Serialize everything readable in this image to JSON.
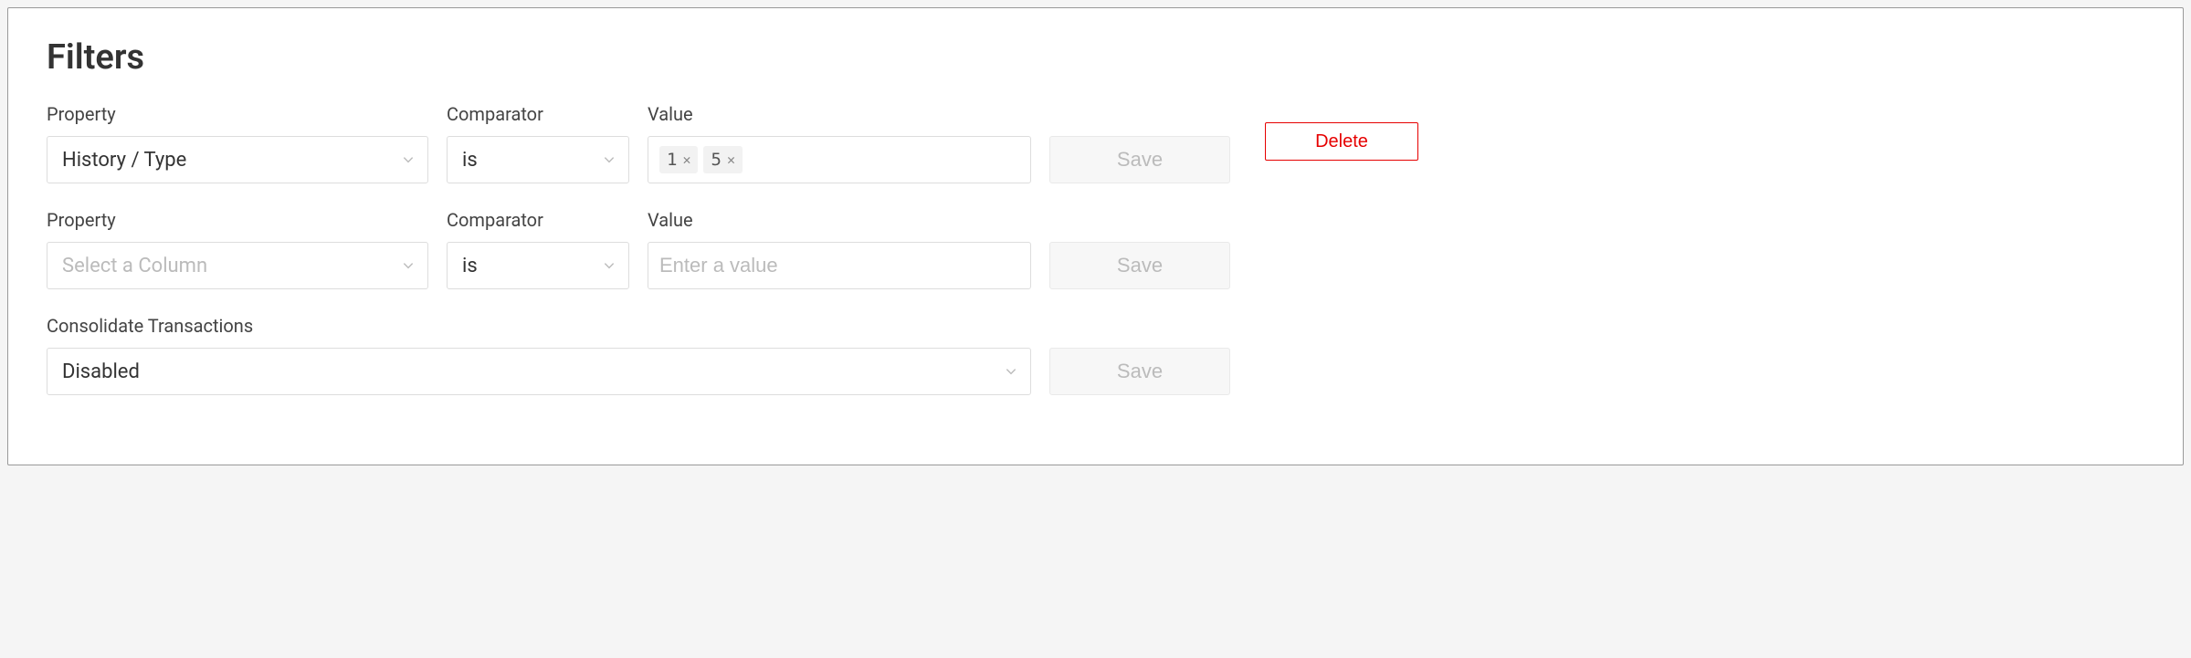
{
  "title": "Filters",
  "labels": {
    "property": "Property",
    "comparator": "Comparator",
    "value": "Value",
    "consolidate": "Consolidate Transactions"
  },
  "actions": {
    "save": "Save",
    "delete": "Delete"
  },
  "placeholders": {
    "selectColumn": "Select a Column",
    "enterValue": "Enter a value"
  },
  "filters": [
    {
      "property": "History / Type",
      "comparator": "is",
      "valueTags": [
        "1",
        "5"
      ]
    },
    {
      "property": "",
      "comparator": "is",
      "value": ""
    }
  ],
  "consolidate": {
    "value": "Disabled"
  }
}
